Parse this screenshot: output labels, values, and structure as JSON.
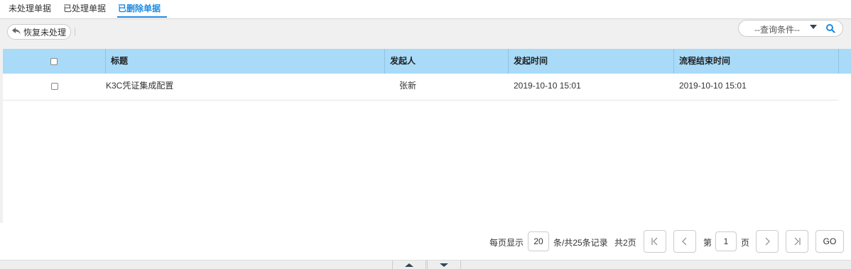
{
  "tabs": [
    {
      "label": "未处理单据"
    },
    {
      "label": "已处理单据"
    },
    {
      "label": "已删除单据",
      "active": true
    }
  ],
  "toolbar": {
    "restore_label": "恢复未处理",
    "query_label": "--查询条件--"
  },
  "table": {
    "columns": [
      "标题",
      "发起人",
      "发起时间",
      "流程结束时间"
    ],
    "rows": [
      {
        "title": "K3C凭证集成配置",
        "initiator": "张新",
        "start_time": "2019-10-10 15:01",
        "end_time": "2019-10-10 15:01"
      }
    ]
  },
  "pager": {
    "per_page_label": "每页显示",
    "per_page_value": "20",
    "total_label": "条/共25条记录",
    "pages_label": "共2页",
    "page_prefix": "第",
    "current_page": "1",
    "page_suffix": "页",
    "go_label": "GO"
  },
  "colors": {
    "accent": "#1e8be0",
    "header_bg": "#a9dbf9"
  }
}
